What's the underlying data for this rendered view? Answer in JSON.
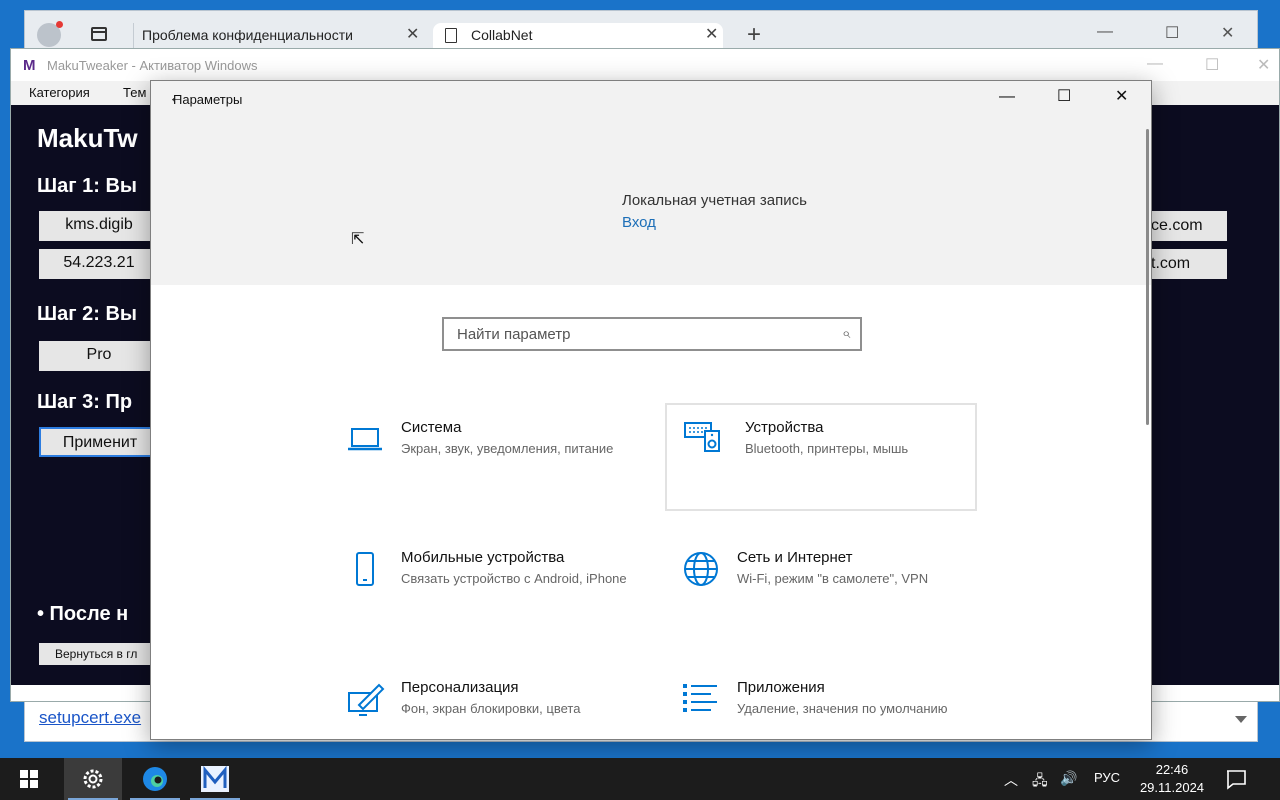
{
  "browser": {
    "tabs": [
      {
        "label": "Проблема конфиденциальности"
      },
      {
        "label": "CollabNet"
      }
    ],
    "bottom_link": "setupcert.exe"
  },
  "maku": {
    "title": "MakuTweaker - Активатор Windows",
    "menu": [
      "Категория",
      "Тем"
    ],
    "heading": "MakuTw",
    "step1": "Шаг 1: Вы",
    "step2": "Шаг 2: Вы",
    "step3": "Шаг 3: Пр",
    "server1": "kms.digib",
    "server2": "54.223.21",
    "edition": "Pro",
    "apply": "Применит",
    "after": "• После н",
    "back": "Вернуться в гл",
    "right1": "ce.com",
    "right2": "t.com"
  },
  "settings": {
    "title": "Параметры",
    "account": "Локальная учетная запись",
    "login": "Вход",
    "search_placeholder": "Найти параметр",
    "tiles": [
      {
        "title": "Система",
        "subtitle": "Экран, звук, уведомления, питание",
        "icon": "laptop-icon"
      },
      {
        "title": "Устройства",
        "subtitle": "Bluetooth, принтеры, мышь",
        "icon": "devices-icon"
      },
      {
        "title": "Мобильные устройства",
        "subtitle": "Связать устройство с Android, iPhone",
        "icon": "phone-icon"
      },
      {
        "title": "Сеть и Интернет",
        "subtitle": "Wi-Fi, режим \"в самолете\", VPN",
        "icon": "globe-icon"
      },
      {
        "title": "Персонализация",
        "subtitle": "Фон, экран блокировки, цвета",
        "icon": "personalization-icon"
      },
      {
        "title": "Приложения",
        "subtitle": "Удаление, значения по умолчанию",
        "icon": "apps-icon"
      }
    ],
    "accent": "#0078d4"
  },
  "taskbar": {
    "language": "РУС",
    "time": "22:46",
    "date": "29.11.2024"
  }
}
